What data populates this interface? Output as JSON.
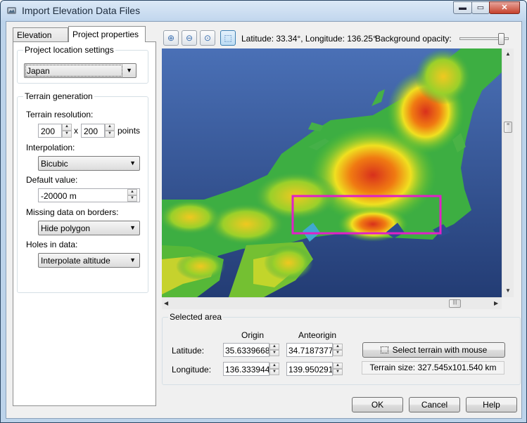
{
  "window": {
    "title": "Import Elevation Data Files",
    "min_glyph": "▬",
    "max_glyph": "▭",
    "close_glyph": "✕"
  },
  "tabs": [
    {
      "label": "Elevation data"
    },
    {
      "label": "Project properties"
    }
  ],
  "location": {
    "group_label": "Project location settings",
    "value": "Japan"
  },
  "terrain": {
    "group_label": "Terrain generation",
    "resolution_label": "Terrain resolution:",
    "res_x": "200",
    "res_sep": "x",
    "res_y": "200",
    "res_unit": "points",
    "interp_label": "Interpolation:",
    "interp_value": "Bicubic",
    "default_label": "Default value:",
    "default_value": "-20000 m",
    "missing_label": "Missing data on borders:",
    "missing_value": "Hide polygon",
    "holes_label": "Holes in data:",
    "holes_value": "Interpolate altitude"
  },
  "map_toolbar": {
    "latlon": "Latitude: 33.34°, Longitude: 136.25°",
    "bg_label": "Background opacity:",
    "bg_opacity": 0.92,
    "tools": [
      "zoom-in-icon",
      "zoom-out-icon",
      "zoom-fit-icon",
      "select-zoom-icon"
    ]
  },
  "selected_area": {
    "group_label": "Selected area",
    "origin_header": "Origin",
    "anti_header": "Anteorigin",
    "lat_label": "Latitude:",
    "lon_label": "Longitude:",
    "lat_origin": "35.6339668",
    "lat_anti": "34.7187377",
    "lon_origin": "136.333944",
    "lon_anti": "139.950291",
    "select_button": "Select terrain with mouse",
    "terrain_size": "Terrain size: 327.545x101.540 km"
  },
  "buttons": {
    "ok": "OK",
    "cancel": "Cancel",
    "help": "Help"
  },
  "colors": {
    "title_bar": "#c2d7ee",
    "selection": "#e020c8",
    "sea": "#2c4e90"
  }
}
